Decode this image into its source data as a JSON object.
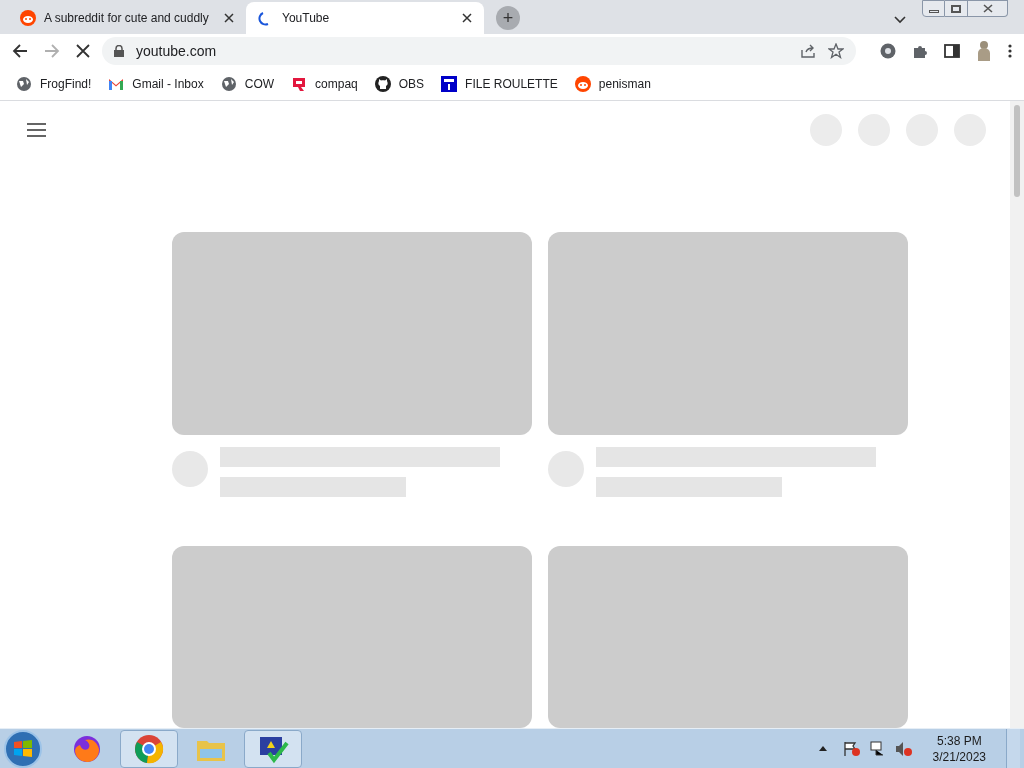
{
  "tabs": [
    {
      "title": "A subreddit for cute and cuddly",
      "kind": "reddit",
      "selected": false
    },
    {
      "title": "YouTube",
      "kind": "spinner",
      "selected": true
    }
  ],
  "new_tab_button": "+",
  "address_bar": {
    "url": "youtube.com",
    "loading": true
  },
  "bookmarks": [
    {
      "label": "FrogFind!",
      "kind": "globe"
    },
    {
      "label": "Gmail - Inbox",
      "kind": "gmail"
    },
    {
      "label": "COW",
      "kind": "globe"
    },
    {
      "label": "compaq",
      "kind": "compaq"
    },
    {
      "label": "OBS",
      "kind": "github"
    },
    {
      "label": "FILE ROULETTE",
      "kind": "mft"
    },
    {
      "label": "penisman",
      "kind": "reddit"
    }
  ],
  "taskbar": {
    "apps": [
      {
        "kind": "fox",
        "running": false
      },
      {
        "kind": "chrome",
        "running": true
      },
      {
        "kind": "folder",
        "running": false
      },
      {
        "kind": "monitor",
        "running": true
      }
    ],
    "time": "5:38 PM",
    "date": "3/21/2023"
  }
}
